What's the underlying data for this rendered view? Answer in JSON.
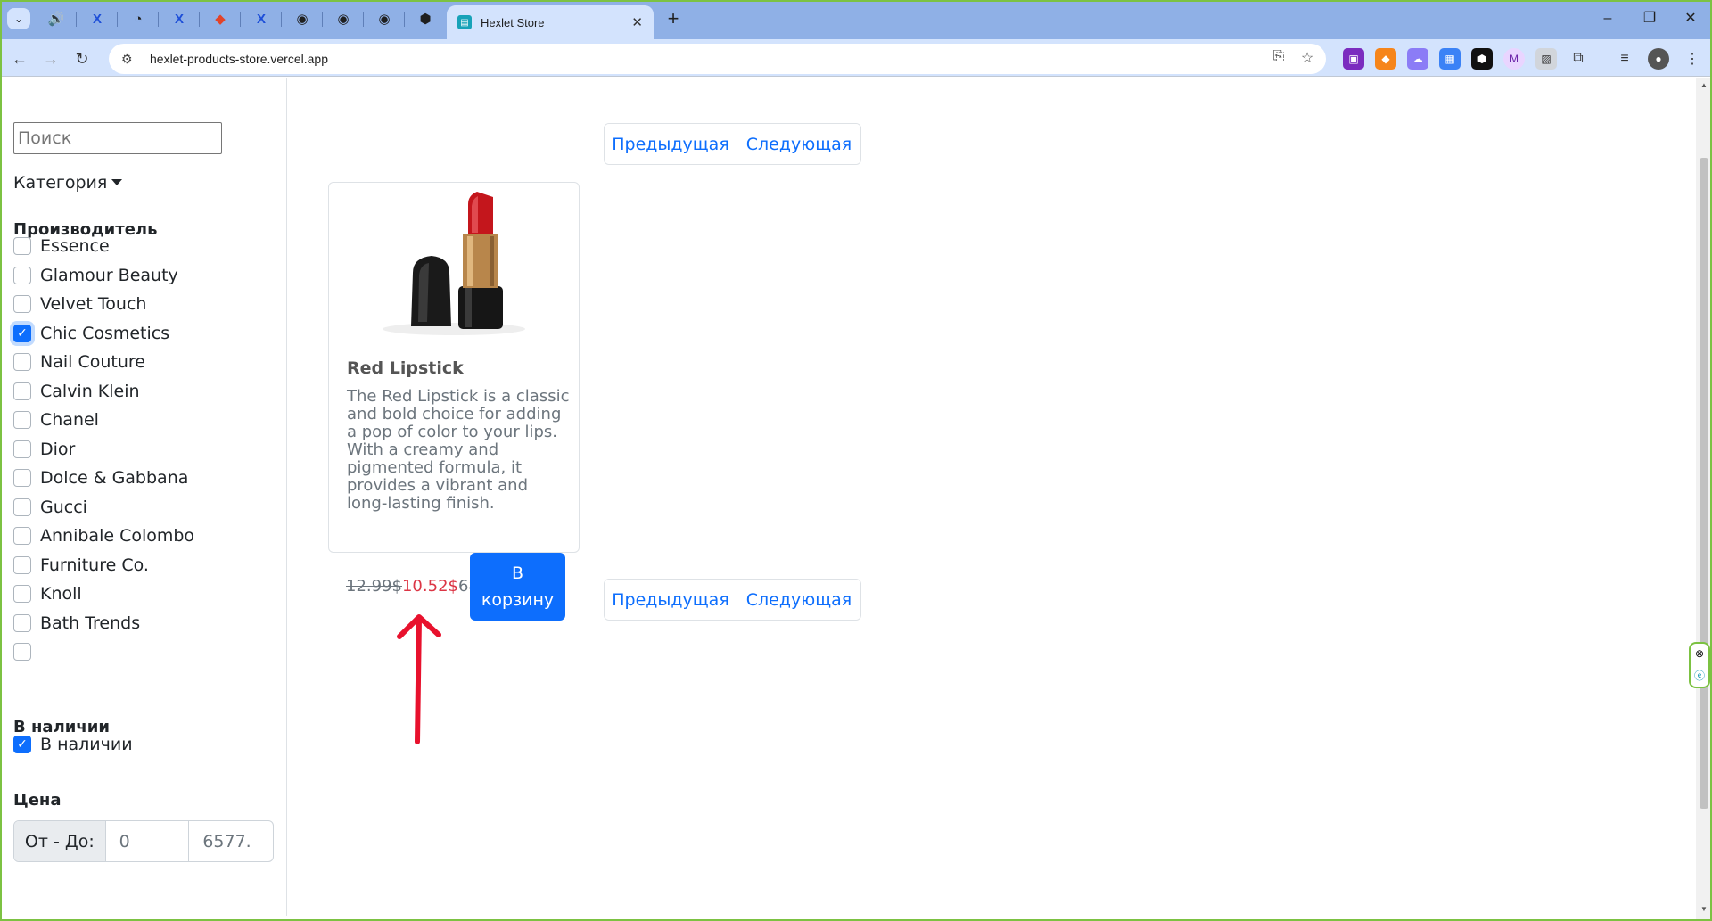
{
  "browser": {
    "active_tab_title": "Hexlet Store",
    "url": "hexlet-products-store.vercel.app",
    "new_tab_symbol": "+",
    "window_controls": [
      "–",
      "❐",
      "✕"
    ]
  },
  "sidebar": {
    "search_placeholder": "Поиск",
    "category_label": "Категория",
    "manufacturer_title": "Производитель",
    "manufacturers": [
      {
        "label": "Essence",
        "checked": false
      },
      {
        "label": "Glamour Beauty",
        "checked": false
      },
      {
        "label": "Velvet Touch",
        "checked": false
      },
      {
        "label": "Chic Cosmetics",
        "checked": true
      },
      {
        "label": "Nail Couture",
        "checked": false
      },
      {
        "label": "Calvin Klein",
        "checked": false
      },
      {
        "label": "Chanel",
        "checked": false
      },
      {
        "label": "Dior",
        "checked": false
      },
      {
        "label": "Dolce & Gabbana",
        "checked": false
      },
      {
        "label": "Gucci",
        "checked": false
      },
      {
        "label": "Annibale Colombo",
        "checked": false
      },
      {
        "label": "Furniture Co.",
        "checked": false
      },
      {
        "label": "Knoll",
        "checked": false
      },
      {
        "label": "Bath Trends",
        "checked": false
      },
      {
        "label": "",
        "checked": false
      }
    ],
    "availability_title": "В наличии",
    "availability_option": {
      "label": "В наличии",
      "checked": true
    },
    "price_title": "Цена",
    "price_addon": "От - До:",
    "price_from": "0",
    "price_to": "6577."
  },
  "pagination": {
    "prev_label": "Предыдущая",
    "next_label": "Следующая"
  },
  "product": {
    "title": "Red Lipstick",
    "description": "The Red Lipstick is a classic and bold choice for adding a pop of color to your lips. With a creamy and pigmented formula, it provides a vibrant and long-lasting finish.",
    "old_price": "12.99$",
    "new_price": "10.52$",
    "stock": "68",
    "cart_button_line1": "В",
    "cart_button_line2": "корзину"
  },
  "colors": {
    "primary": "#0d6efd",
    "discount": "#dc3545",
    "annotation": "#e8112d",
    "window_border": "#7cc242"
  }
}
